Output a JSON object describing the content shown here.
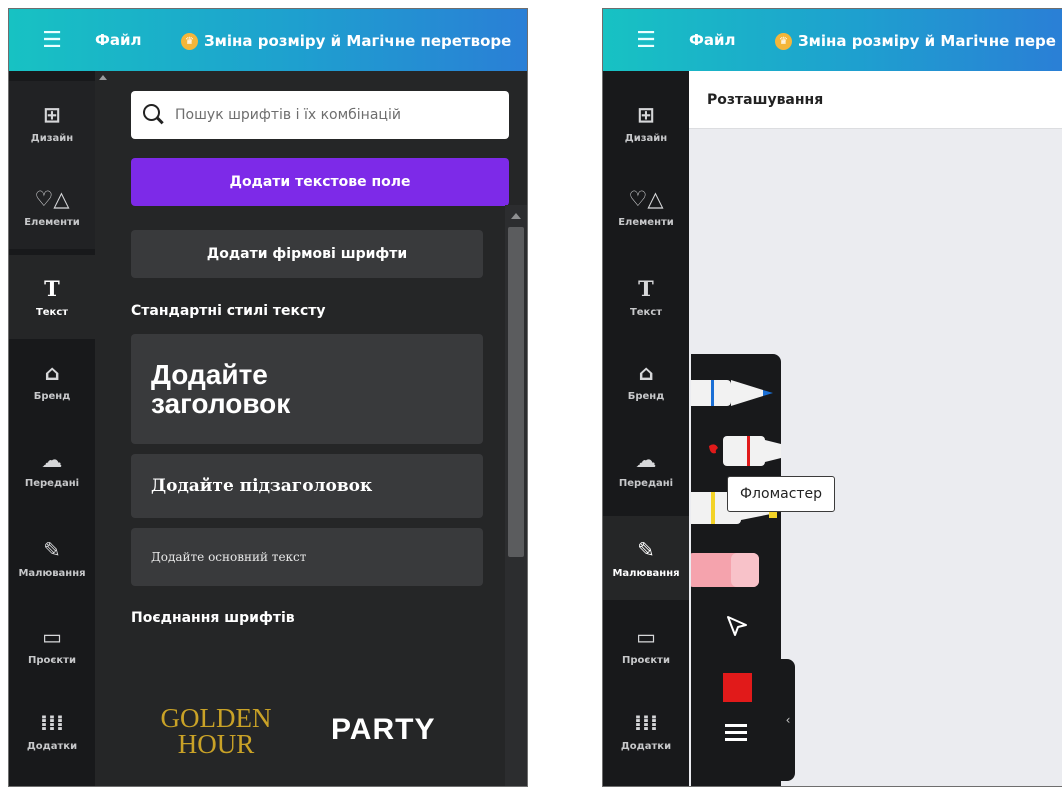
{
  "left_screen": {
    "topbar": {
      "menu_icon": "hamburger-icon",
      "file_label": "Файл",
      "resize_label": "Зміна розміру й Магічне перетворе"
    },
    "rail": [
      {
        "label": "Дизайн",
        "icon": "layout-icon"
      },
      {
        "label": "Елементи",
        "icon": "shapes-icon"
      },
      {
        "label": "Текст",
        "icon": "text-icon",
        "active": true
      },
      {
        "label": "Бренд",
        "icon": "brand-icon"
      },
      {
        "label": "Передані",
        "icon": "upload-cloud-icon"
      },
      {
        "label": "Малювання",
        "icon": "draw-icon"
      },
      {
        "label": "Проєкти",
        "icon": "folder-icon"
      },
      {
        "label": "Додатки",
        "icon": "apps-grid-icon"
      }
    ],
    "panel": {
      "search_placeholder": "Пошук шрифтів і їх комбінацій",
      "add_text_box": "Додати текстове поле",
      "add_brand_fonts": "Додати фірмові шрифти",
      "default_styles_title": "Стандартні стилі тексту",
      "heading_sample": "Додайте заголовок",
      "subheading_sample": "Додайте підзаголовок",
      "body_sample": "Додайте основний текст",
      "combinations_title": "Поєднання шрифтів",
      "combo_1_line1": "GOLDEN",
      "combo_1_line2": "HOUR",
      "combo_2": "PARTY"
    }
  },
  "right_screen": {
    "topbar": {
      "menu_icon": "hamburger-icon",
      "file_label": "Файл",
      "resize_label": "Зміна розміру й Магічне пере"
    },
    "rail": [
      {
        "label": "Дизайн",
        "icon": "layout-icon"
      },
      {
        "label": "Елементи",
        "icon": "shapes-icon"
      },
      {
        "label": "Текст",
        "icon": "text-icon"
      },
      {
        "label": "Бренд",
        "icon": "brand-icon"
      },
      {
        "label": "Передані",
        "icon": "upload-cloud-icon"
      },
      {
        "label": "Малювання",
        "icon": "draw-icon",
        "active": true
      },
      {
        "label": "Проєкти",
        "icon": "folder-icon"
      },
      {
        "label": "Додатки",
        "icon": "apps-grid-icon"
      }
    ],
    "position_bar_label": "Розташування",
    "draw_tools": {
      "pen_colors": [
        "#1a6fd6",
        "#e11a1a",
        "#f3d327"
      ],
      "eraser_color": "#f5a3ad",
      "tooltip": "Фломастер",
      "selected_color": "#e11a1a"
    }
  },
  "colors": {
    "accent_purple": "#7d2ae8",
    "topbar_start": "#17c2c3",
    "topbar_end": "#2a7fd6",
    "panel_bg": "#252627",
    "rail_bg": "#18191b"
  }
}
